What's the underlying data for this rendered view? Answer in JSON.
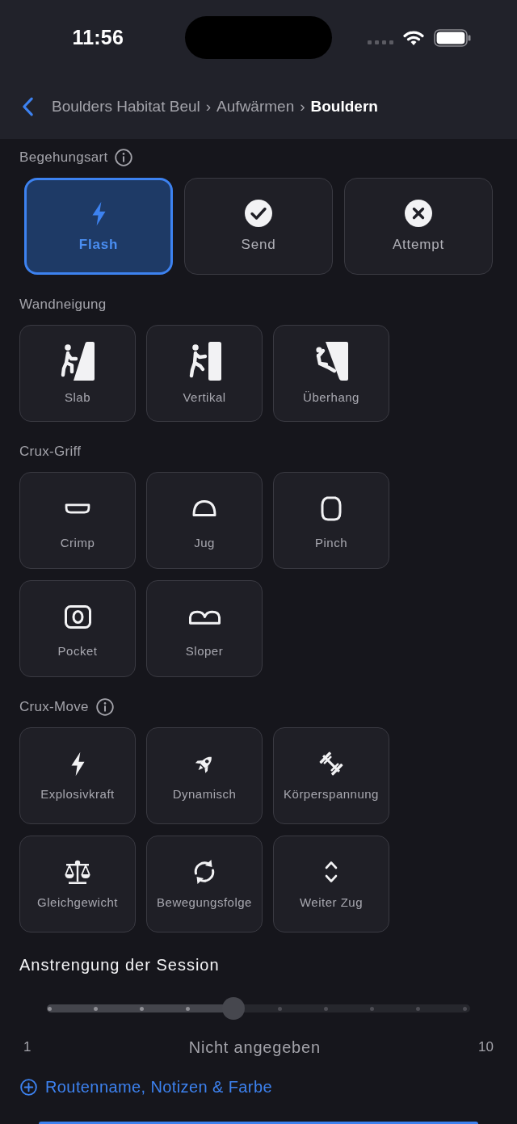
{
  "status_bar": {
    "time": "11:56"
  },
  "nav": {
    "breadcrumbs": [
      {
        "label": "Boulders Habitat Beul",
        "current": false,
        "separator": "›"
      },
      {
        "label": "Aufwärmen",
        "current": false,
        "separator": "›"
      },
      {
        "label": "Bouldern",
        "current": true
      }
    ]
  },
  "sections": [
    {
      "kind": "segmented",
      "title": "Begehungsart",
      "info": true,
      "options": [
        {
          "label": "Flash",
          "selected": true
        },
        {
          "label": "Send",
          "selected": false
        },
        {
          "label": "Attempt",
          "selected": false
        }
      ]
    },
    {
      "kind": "tiles",
      "title": "Wandneigung",
      "info": false,
      "options": [
        {
          "label": "Slab",
          "selected": false
        },
        {
          "label": "Vertikal",
          "selected": false
        },
        {
          "label": "Überhang",
          "selected": false
        }
      ]
    },
    {
      "kind": "tiles",
      "title": "Crux-Griff",
      "info": false,
      "options": [
        {
          "label": "Crimp",
          "selected": false
        },
        {
          "label": "Jug",
          "selected": false
        },
        {
          "label": "Pinch",
          "selected": false
        },
        {
          "label": "Pocket",
          "selected": false
        },
        {
          "label": "Sloper",
          "selected": false
        }
      ]
    },
    {
      "kind": "tiles",
      "title": "Crux-Move",
      "info": true,
      "options": [
        {
          "label": "Explosivkraft",
          "selected": false
        },
        {
          "label": "Dynamisch",
          "selected": false
        },
        {
          "label": "Körperspannung",
          "selected": false
        },
        {
          "label": "Gleichgewicht",
          "selected": false
        },
        {
          "label": "Bewegungsfolge",
          "selected": false
        },
        {
          "label": "Weiter Zug",
          "selected": false
        }
      ]
    },
    {
      "kind": "slider",
      "title": "Anstrengung der Session",
      "level": 0.444,
      "min_label": "1",
      "value_label": "Nicht angegeben",
      "max_label": "10"
    }
  ],
  "link": {
    "label": "Routenname, Notizen & Farbe"
  }
}
